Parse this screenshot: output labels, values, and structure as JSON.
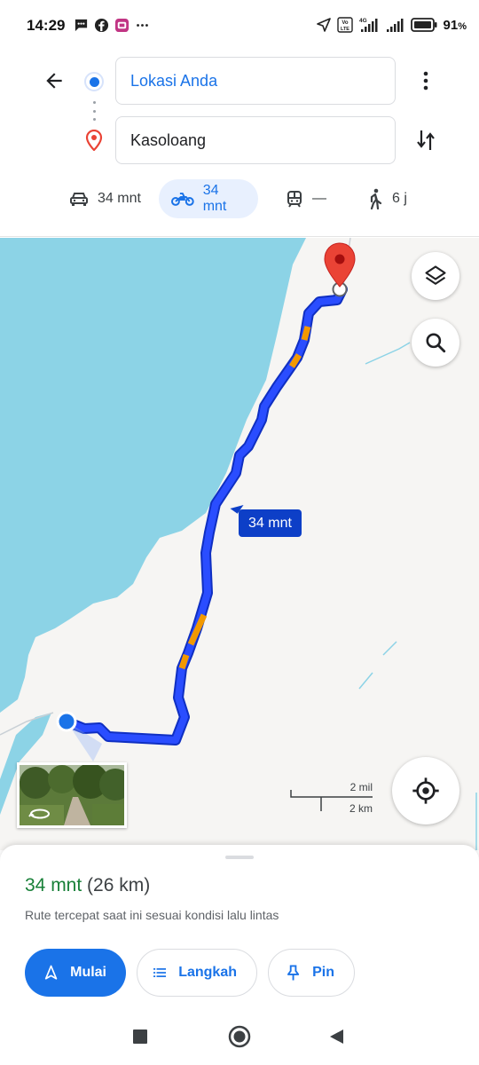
{
  "status_bar": {
    "time": "14:29",
    "battery_percent": "91",
    "battery_suffix": "%",
    "icons": [
      "message-icon",
      "facebook-icon",
      "app-icon",
      "more-notifications-icon",
      "location-arrow-icon",
      "volte-icon",
      "signal-4g-icon",
      "signal-icon",
      "battery-icon"
    ]
  },
  "directions": {
    "origin": "Lokasi Anda",
    "destination": "Kasoloang",
    "modes": [
      {
        "name": "car",
        "time": "34 mnt",
        "active": false
      },
      {
        "name": "motorcycle",
        "time": "34 mnt",
        "active": true
      },
      {
        "name": "transit",
        "time": "—",
        "active": false
      },
      {
        "name": "walk",
        "time": "6 j",
        "active": false
      }
    ]
  },
  "map": {
    "route_label": "34 mnt",
    "scale_top": "2 mil",
    "scale_bottom": "2 km",
    "colors": {
      "water": "#8cd3e6",
      "land": "#f6f5f3",
      "route": "#1a3ff0",
      "traffic_slow": "#f29900",
      "pin": "#ea4335"
    }
  },
  "sheet": {
    "duration": "34 mnt",
    "distance": "(26 km)",
    "description": "Rute tercepat saat ini sesuai kondisi lalu lintas",
    "start_label": "Mulai",
    "steps_label": "Langkah",
    "pin_label": "Pin"
  }
}
